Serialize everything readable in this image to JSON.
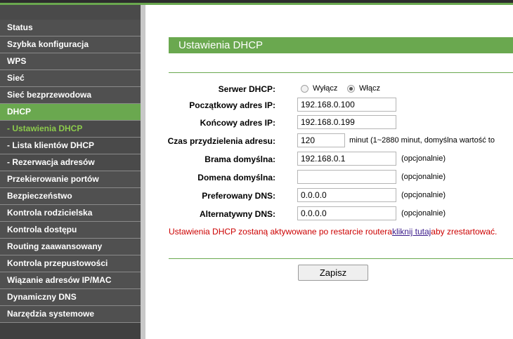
{
  "sidebar": {
    "items": [
      {
        "label": "Status"
      },
      {
        "label": "Szybka konfiguracja"
      },
      {
        "label": "WPS"
      },
      {
        "label": "Sieć"
      },
      {
        "label": "Sieć bezprzewodowa"
      },
      {
        "label": "DHCP"
      },
      {
        "label": "- Ustawienia DHCP"
      },
      {
        "label": "- Lista klientów DHCP"
      },
      {
        "label": "- Rezerwacja adresów"
      },
      {
        "label": "Przekierowanie portów"
      },
      {
        "label": "Bezpieczeństwo"
      },
      {
        "label": "Kontrola rodzicielska"
      },
      {
        "label": "Kontrola dostępu"
      },
      {
        "label": "Routing zaawansowany"
      },
      {
        "label": "Kontrola przepustowości"
      },
      {
        "label": "Wiązanie adresów IP/MAC"
      },
      {
        "label": "Dynamiczny DNS"
      },
      {
        "label": "Narzędzia systemowe"
      }
    ]
  },
  "page": {
    "title": "Ustawienia DHCP"
  },
  "form": {
    "server": {
      "label": "Serwer DHCP:",
      "off_label": "Wyłącz",
      "on_label": "Włącz",
      "selected": "Włącz"
    },
    "start_ip": {
      "label": "Początkowy adres IP:",
      "value": "192.168.0.100"
    },
    "end_ip": {
      "label": "Końcowy adres IP:",
      "value": "192.168.0.199"
    },
    "lease": {
      "label": "Czas przydzielenia adresu:",
      "value": "120",
      "hint": "minut (1~2880 minut, domyślna wartość to"
    },
    "gateway": {
      "label": "Brama domyślna:",
      "value": "192.168.0.1",
      "hint": "(opcjonalnie)"
    },
    "domain": {
      "label": "Domena domyślna:",
      "value": "",
      "hint": "(opcjonalnie)"
    },
    "dns1": {
      "label": "Preferowany DNS:",
      "value": "0.0.0.0",
      "hint": "(opcjonalnie)"
    },
    "dns2": {
      "label": "Alternatywny DNS:",
      "value": "0.0.0.0",
      "hint": "(opcjonalnie)"
    }
  },
  "notice": {
    "before": "Ustawienia DHCP zostaną aktywowane po restarcie routera",
    "link": "kliknij tutaj",
    "after": "aby zrestartować."
  },
  "actions": {
    "save_label": "Zapisz"
  },
  "colors": {
    "accent_green": "#6aa84f",
    "sidebar_bg": "#505050",
    "notice_red": "#cc0000"
  }
}
